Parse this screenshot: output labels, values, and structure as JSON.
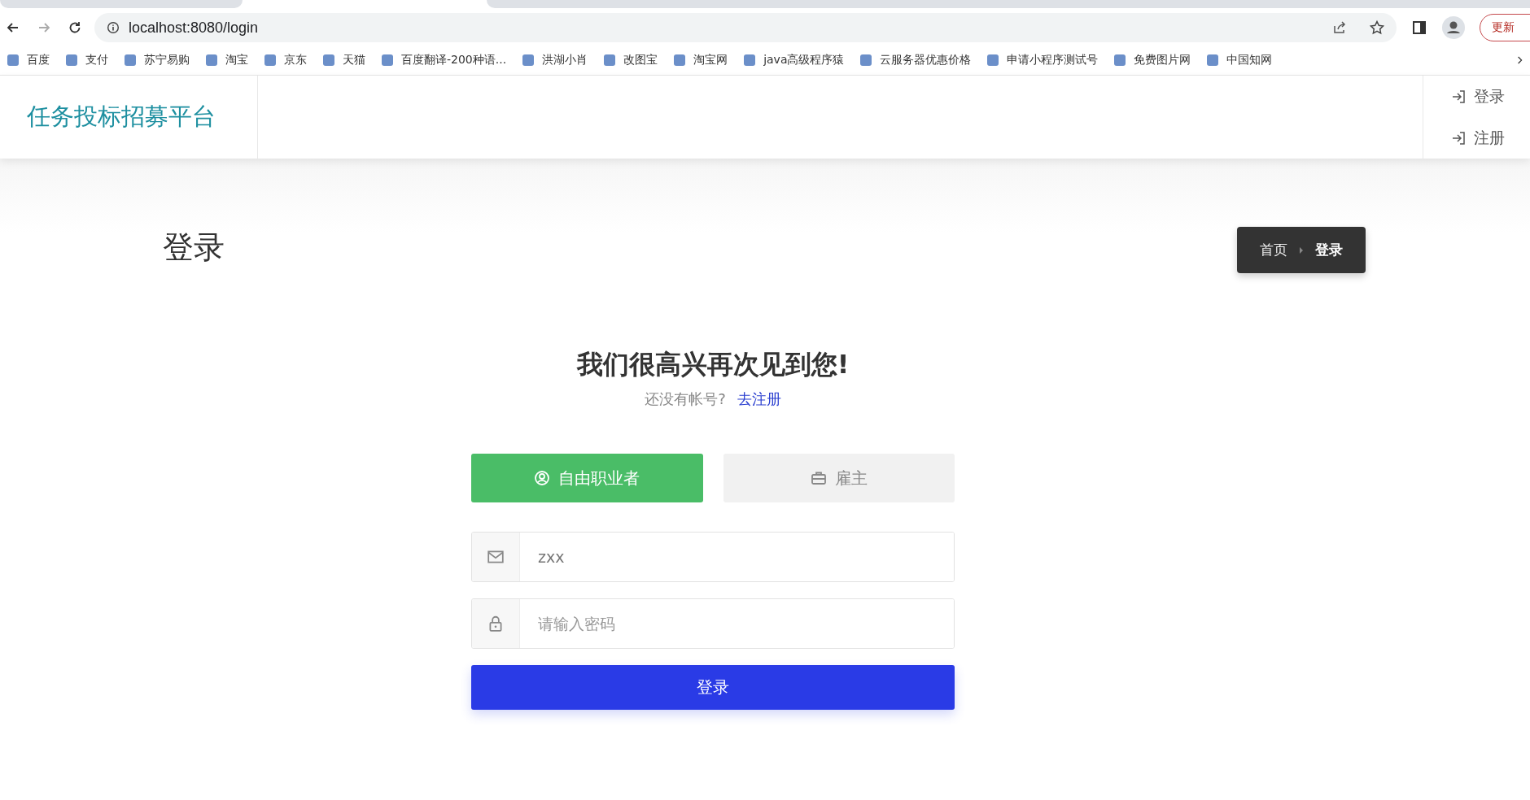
{
  "browser": {
    "url": "localhost:8080/login",
    "update_button": "更新",
    "bookmarks": [
      {
        "label": "百度"
      },
      {
        "label": "支付"
      },
      {
        "label": "苏宁易购"
      },
      {
        "label": "淘宝"
      },
      {
        "label": "京东"
      },
      {
        "label": "天猫"
      },
      {
        "label": "百度翻译-200种语..."
      },
      {
        "label": "洪湖小肖"
      },
      {
        "label": "改图宝"
      },
      {
        "label": "淘宝网"
      },
      {
        "label": "java高级程序猿"
      },
      {
        "label": "云服务器优惠价格"
      },
      {
        "label": "申请小程序测试号"
      },
      {
        "label": "免费图片网"
      },
      {
        "label": "中国知网"
      }
    ]
  },
  "header": {
    "logo": "任务投标招募平台",
    "nav": [
      {
        "label": "登录"
      },
      {
        "label": "注册"
      }
    ]
  },
  "page_title": "登录",
  "breadcrumb": [
    {
      "label": "首页",
      "current": false
    },
    {
      "label": "登录",
      "current": true
    }
  ],
  "login": {
    "heading": "我们很高兴再次见到您!",
    "prompt": "还没有帐号?",
    "register_link": "去注册",
    "roles": [
      {
        "label": "自由职业者",
        "kind": "person",
        "selected": true
      },
      {
        "label": "雇主",
        "kind": "briefcase",
        "selected": false
      }
    ],
    "fields": [
      {
        "kind": "email",
        "value": "zxx"
      },
      {
        "kind": "password",
        "placeholder": "请输入密码"
      }
    ],
    "submit": "登录"
  }
}
